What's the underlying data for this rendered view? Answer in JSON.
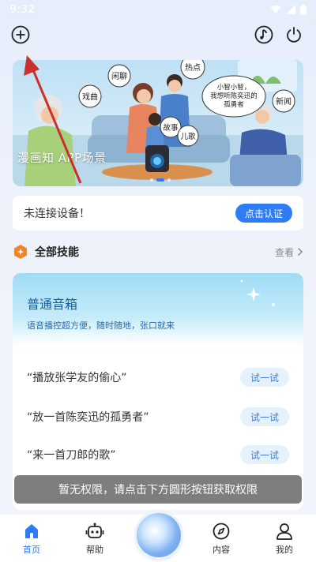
{
  "status_bar": {
    "time": "9:32"
  },
  "banner": {
    "caption": "漫画知 APP场景",
    "bubbles": [
      "热点",
      "闲聊",
      "戏曲",
      "小智小智，\n我想听陈奕迅的\n孤勇者",
      "新闻",
      "故事",
      "儿歌"
    ]
  },
  "device": {
    "status": "未连接设备！",
    "auth_button": "点击认证"
  },
  "skills": {
    "title": "全部技能",
    "view_link": "查看",
    "card": {
      "name": "普通音箱",
      "description": "语音播控超方便，随时随地，张口就来",
      "examples": [
        {
          "text": "“播放张学友的偷心”",
          "button": "试一试"
        },
        {
          "text": "“放一首陈奕迅的孤勇者”",
          "button": "试一试"
        },
        {
          "text": "“来一首刀郎的歌”",
          "button": "试一试"
        }
      ]
    }
  },
  "toast": "暂无权限，请点击下方圆形按钮获取权限",
  "nav": {
    "home": "首页",
    "help": "帮助",
    "content": "内容",
    "me": "我的"
  },
  "colors": {
    "accent": "#2e7cf6",
    "skill_orange": "#f2832b"
  }
}
